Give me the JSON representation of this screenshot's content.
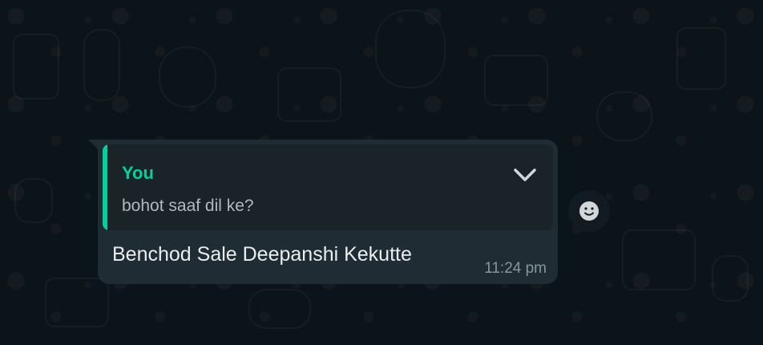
{
  "chat": {
    "quoted_reply": {
      "author": "You",
      "text": "bohot saaf dil ke?"
    },
    "message": {
      "text": "Benchod Sale Deepanshi Kekutte",
      "timestamp": "11:24 pm"
    },
    "icons": {
      "menu": "chevron-down-icon",
      "reaction": "emoji-smile-icon"
    },
    "colors": {
      "background": "#0b141a",
      "bubble": "#202c33",
      "quote_bar": "#06cf9c",
      "text": "#e9edef",
      "muted": "#8696a0"
    }
  }
}
